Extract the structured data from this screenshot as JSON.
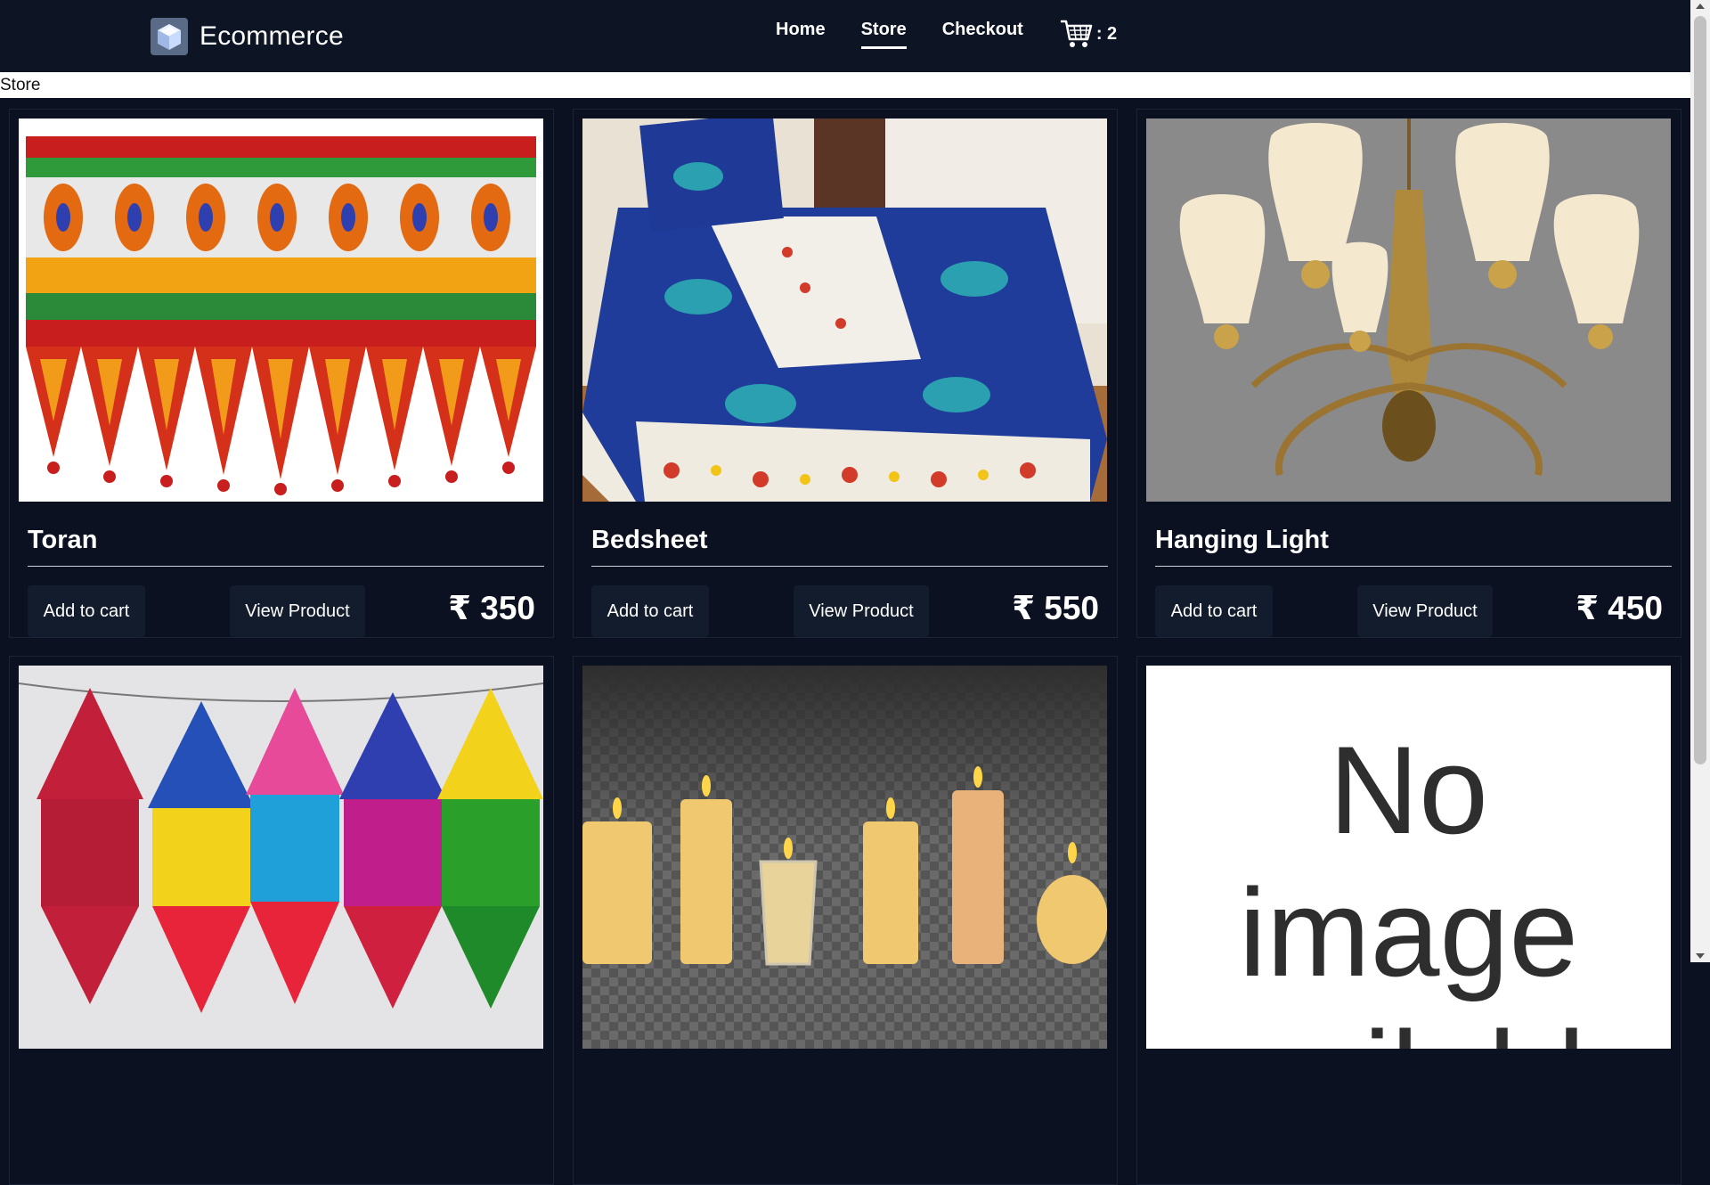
{
  "brand": {
    "name": "Ecommerce",
    "logo_icon": "cube-logo-icon"
  },
  "nav": {
    "links": [
      {
        "label": "Home",
        "active": false
      },
      {
        "label": "Store",
        "active": true
      },
      {
        "label": "Checkout",
        "active": false
      }
    ],
    "cart": {
      "icon": "cart-icon",
      "label": ": 2"
    }
  },
  "breadcrumb": "Store",
  "buttons": {
    "add": "Add to cart",
    "view": "View Product"
  },
  "products": [
    {
      "name": "Toran",
      "price": "₹ 350",
      "image": "toran-image"
    },
    {
      "name": "Bedsheet",
      "price": "₹ 550",
      "image": "bedsheet-image"
    },
    {
      "name": "Hanging Light",
      "price": "₹ 450",
      "image": "chandelier-image"
    },
    {
      "name": "",
      "price": "",
      "image": "lanterns-image"
    },
    {
      "name": "",
      "price": "",
      "image": "candles-image"
    },
    {
      "name": "",
      "price": "",
      "image": "no-image-placeholder",
      "placeholder_text": "No image available"
    }
  ],
  "colors": {
    "background": "#0b1120",
    "navbar": "#0d1525",
    "button": "#131c2c",
    "text": "#ffffff"
  }
}
